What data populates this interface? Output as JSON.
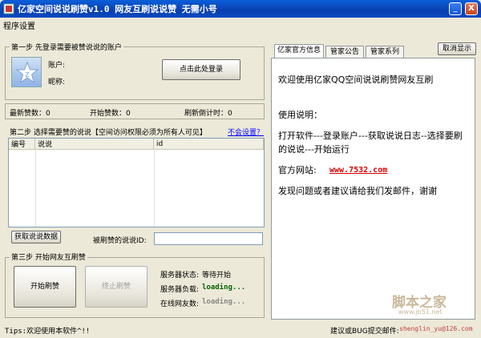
{
  "window": {
    "title": "亿家空间说说刷赞v1.0  网友互刷说说赞  无需小号",
    "btn_minimize": "_",
    "btn_close": "X"
  },
  "menu": {
    "settings": "程序设置"
  },
  "step1": {
    "title": "第一步  先登录需要被赞说说的账户",
    "account_label": "账户:",
    "nickname_label": "昵称:",
    "login_button": "点击此处登录"
  },
  "stats": {
    "latest_likes": "最新赞数：0",
    "start_likes": "开始赞数：0",
    "countdown": "刷新倒计时：0"
  },
  "step2": {
    "title": "第二步  选择需要赞的说说【空间访问权限必须为所有人可见】",
    "help_link": "不会设置？",
    "columns": [
      "编号",
      "说说",
      "id"
    ],
    "fetch_button": "获取说说数据",
    "id_label": "被刷赞的说说ID:",
    "id_value": ""
  },
  "step3": {
    "title": "第三步  开始网友互刷赞",
    "start_button": "开始刷赞",
    "stop_button": "终止刷赞",
    "server_status_label": "服务器状态:",
    "server_status_value": "等待开始",
    "server_load_label": "服务器负载:",
    "server_load_value": "loading...",
    "online_label": "在线网友数:",
    "online_value": "loading..."
  },
  "tabs": {
    "official": "亿家官方信息",
    "notice": "管家公告",
    "series": "管家系列",
    "cancel_display": "取消显示"
  },
  "info_text": {
    "welcome": "欢迎使用亿家QQ空间说说刷赞网友互刷",
    "usage_title": "使用说明：",
    "usage_body": "打开软件---登录账户---获取说说日志--选择要刷的说说---开始运行",
    "website_label": "官方网站:",
    "website_url": "www.7532.com",
    "contact": "发现问题或者建议请给我们发邮件，谢谢"
  },
  "statusbar": {
    "tips": "Tips:欢迎使用本软件^!!",
    "suggest": "建议或BUG提交邮件:",
    "email": "shenglin_yu@126.com"
  },
  "watermark": {
    "text": "脚本之家",
    "url": "www.jb51.net"
  },
  "colors": {
    "title_bar": "#0a4fc8",
    "link": "#0000ff",
    "url": "#d40000",
    "loading": "#006600"
  }
}
